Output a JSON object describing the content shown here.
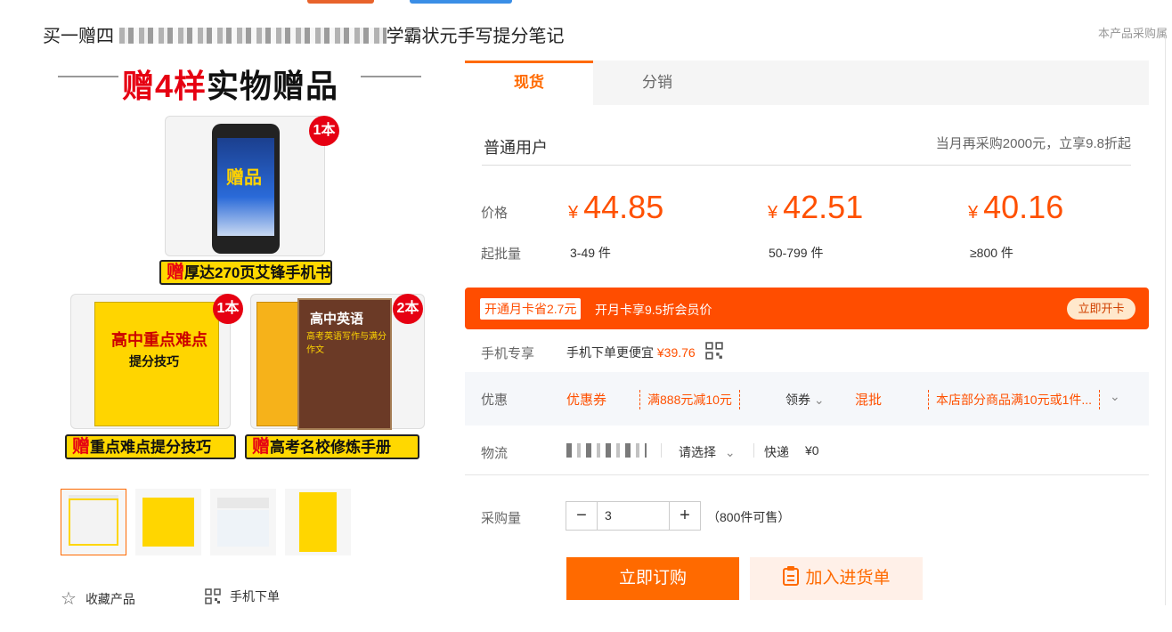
{
  "header": {
    "title_prefix": "买一赠四",
    "title_suffix": "学霸状元手写提分笔记",
    "top_note": "本产品采购属"
  },
  "gallery": {
    "banner": {
      "red": "赠4样",
      "black": "实物赠品"
    },
    "gift_phone": {
      "screen_text": "赠品",
      "badge": "1本",
      "label_z": "赠",
      "label": "厚达270页艾锋手机书"
    },
    "gift_book1": {
      "title": "高中重点难点",
      "sub": "提分技巧",
      "badge": "1本",
      "label_z": "赠",
      "label": "重点难点提分技巧"
    },
    "gift_book2": {
      "title": "高中英语",
      "sub": "高考英语写作与满分作文",
      "badge": "2本",
      "label_z": "赠",
      "label": "高考名校修炼手册"
    },
    "thumbnails": [
      "thumb-1",
      "thumb-2",
      "thumb-3",
      "thumb-4"
    ]
  },
  "actions": {
    "favorite": "收藏产品",
    "mobile_order": "手机下单"
  },
  "tabs": [
    "现货",
    "分销"
  ],
  "user": {
    "type": "普通用户",
    "discount_note": "当月再采购2000元，立享9.8折起"
  },
  "pricing": {
    "price_label": "价格",
    "moq_label": "起批量",
    "currency": "¥",
    "tiers": [
      {
        "price": "44.85",
        "range": "3-49 件"
      },
      {
        "price": "42.51",
        "range": "50-799 件"
      },
      {
        "price": "40.16",
        "range": "≥800 件"
      }
    ]
  },
  "promo": {
    "chip": "开通月卡省2.7元",
    "text": "开月卡享9.5折会员价",
    "button": "立即开卡"
  },
  "mobile": {
    "label": "手机专享",
    "text": "手机下单更便宜",
    "price": "¥39.76"
  },
  "discount": {
    "label": "优惠",
    "coupon_label": "优惠券",
    "coupon": "满888元减10元",
    "get_coupon": "领券",
    "mix_label": "混批",
    "mix": "本店部分商品满10元或1件..."
  },
  "logistics": {
    "label": "物流",
    "select": "请选择",
    "method": "快递",
    "fee": "¥0"
  },
  "quantity": {
    "label": "采购量",
    "value": "3",
    "stock": "（800件可售）"
  },
  "buttons": {
    "order": "立即订购",
    "cart": "加入进货单"
  },
  "colors": {
    "accent": "#ff6a00",
    "price": "#ff5000",
    "promo_bg": "#ff4d00"
  }
}
